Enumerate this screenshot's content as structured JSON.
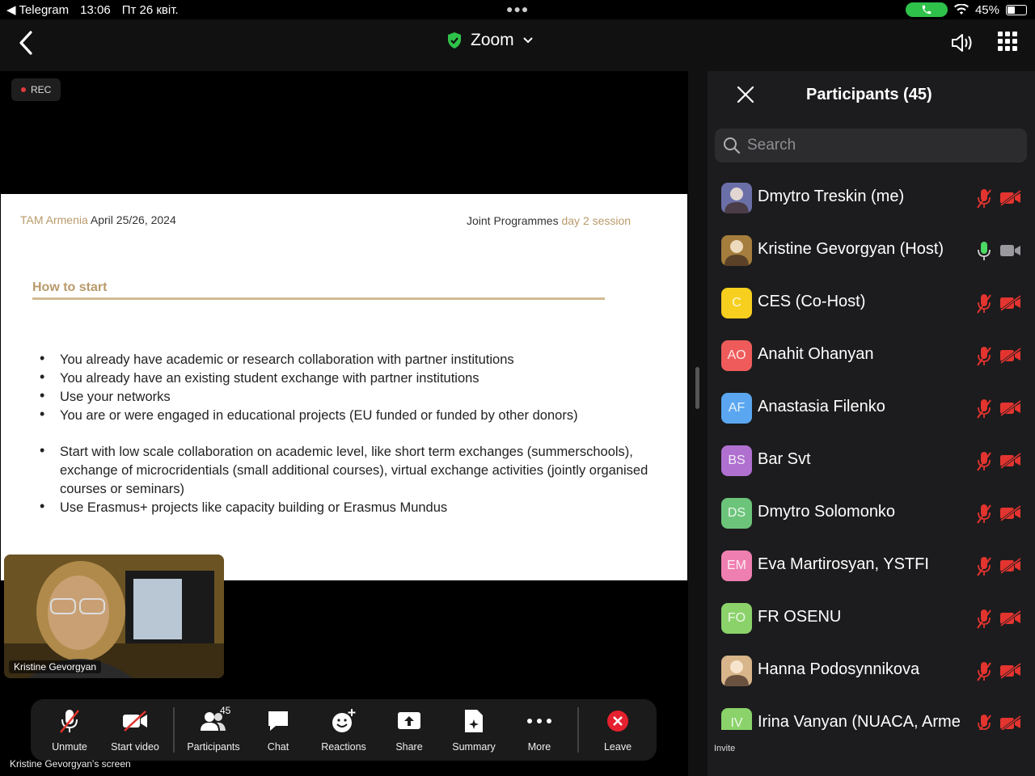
{
  "status_bar": {
    "back_app": "Telegram",
    "time": "13:06",
    "date": "Пт 26 квіт.",
    "battery": "45%",
    "battery_level": 0.45
  },
  "header": {
    "title": "Zoom"
  },
  "stage": {
    "rec_label": "REC",
    "slide": {
      "header_left_brand": "TAM Armenia",
      "header_left_date": "April 25/26, 2024",
      "header_right_main": "Joint Programmes",
      "header_right_accent": "day 2 session",
      "heading": "How to start",
      "bullets": [
        "You already have academic or research collaboration with partner institutions",
        "You already have an existing student exchange with partner institutions",
        "Use your networks",
        "You are or were engaged in educational projects (EU funded or funded by other donors)",
        "Start with low scale collaboration on academic level, like short term exchanges (summerschools), exchange of microcridentials (small additional courses), virtual exchange activities (jointly organised courses or seminars)",
        "Use Erasmus+ projects like capacity building or Erasmus Mundus"
      ]
    },
    "self_view_name": "Kristine Gevorgyan",
    "screen_label": "Kristine Gevorgyan's screen"
  },
  "toolbar": {
    "unmute": "Unmute",
    "start_video": "Start video",
    "participants": "Participants",
    "participants_count": "45",
    "chat": "Chat",
    "reactions": "Reactions",
    "share": "Share",
    "summary": "Summary",
    "more": "More",
    "leave": "Leave"
  },
  "panel": {
    "title": "Participants (45)",
    "search_placeholder": "Search",
    "invite": "Invite",
    "participants": [
      {
        "name": "Dmytro Treskin (me)",
        "initials": "",
        "color": "#6b6fa8",
        "mic": "muted",
        "video": "off"
      },
      {
        "name": "Kristine Gevorgyan (Host)",
        "initials": "",
        "color": "#a57d3c",
        "mic": "on",
        "video": "on"
      },
      {
        "name": "CES (Co-Host)",
        "initials": "C",
        "color": "#f6cf1f",
        "mic": "muted",
        "video": "off"
      },
      {
        "name": "Anahit Ohanyan",
        "initials": "AO",
        "color": "#ef5b5b",
        "mic": "muted",
        "video": "off"
      },
      {
        "name": "Anastasia Filenko",
        "initials": "AF",
        "color": "#5aa6f0",
        "mic": "muted",
        "video": "off"
      },
      {
        "name": "Bar Svt",
        "initials": "BS",
        "color": "#b070d0",
        "mic": "muted",
        "video": "off"
      },
      {
        "name": "Dmytro Solomonko",
        "initials": "DS",
        "color": "#6cc47a",
        "mic": "muted",
        "video": "off"
      },
      {
        "name": "Eva Martirosyan, YSTFI",
        "initials": "EM",
        "color": "#ef7fb0",
        "mic": "muted",
        "video": "off"
      },
      {
        "name": "FR OSENU",
        "initials": "FO",
        "color": "#8bd26b",
        "mic": "muted",
        "video": "off"
      },
      {
        "name": "Hanna Podosynnikova",
        "initials": "",
        "color": "#d8b58a",
        "mic": "muted",
        "video": "off"
      },
      {
        "name": "Irina Vanyan (NUACA, Arme",
        "initials": "IV",
        "color": "#8bd26b",
        "mic": "muted",
        "video": "off"
      }
    ]
  },
  "colors": {
    "accent_green": "#2fc24a",
    "muted_red": "#e3342f",
    "leave_red": "#e5212f",
    "slide_gold": "#b99a6b"
  }
}
